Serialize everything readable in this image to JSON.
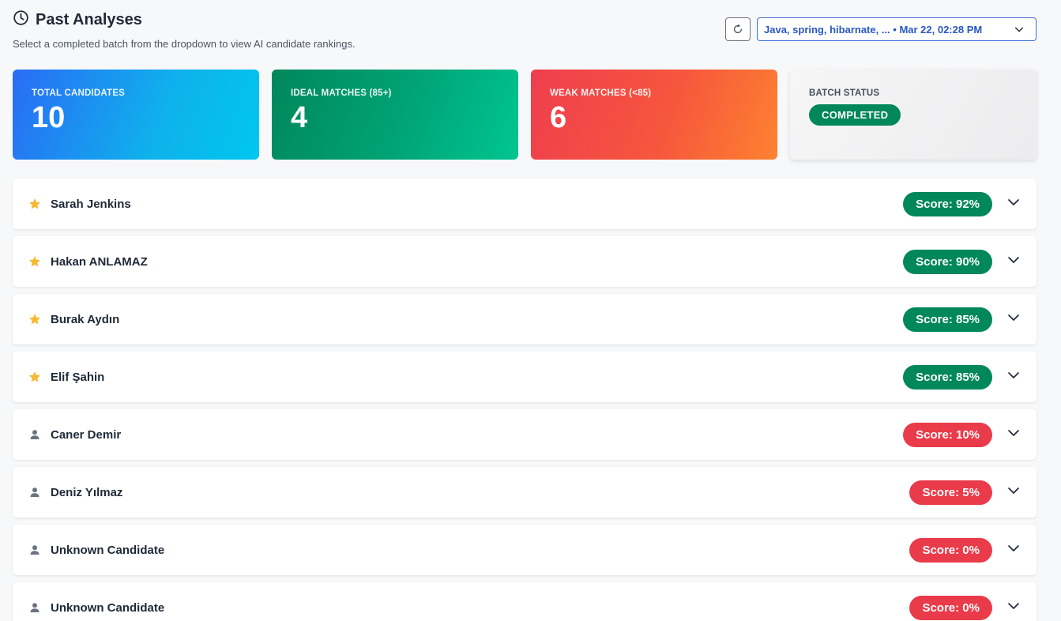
{
  "header": {
    "title": "Past Analyses",
    "subtitle": "Select a completed batch from the dropdown to view AI candidate rankings."
  },
  "controls": {
    "batch_selected": "Java, spring, hibarnate, ... • Mar 22, 02:28 PM"
  },
  "stats": [
    {
      "label": "TOTAL CANDIDATES",
      "value": "10"
    },
    {
      "label": "IDEAL MATCHES (85+)",
      "value": "4"
    },
    {
      "label": "WEAK MATCHES (<85)",
      "value": "6"
    }
  ],
  "status": {
    "label": "BATCH STATUS",
    "value": "COMPLETED"
  },
  "candidates": [
    {
      "name": "Sarah Jenkins",
      "score": "Score: 92%",
      "icon": "star-icon"
    },
    {
      "name": "Hakan ANLAMAZ",
      "score": "Score: 90%",
      "icon": "star-icon"
    },
    {
      "name": "Burak Aydın",
      "score": "Score: 85%",
      "icon": "star-icon"
    },
    {
      "name": "Elif Şahin",
      "score": "Score: 85%",
      "icon": "star-icon"
    },
    {
      "name": "Caner Demir",
      "score": "Score: 10%",
      "icon": "user-icon"
    },
    {
      "name": "Deniz Yılmaz",
      "score": "Score: 5%",
      "icon": "user-icon"
    },
    {
      "name": "Unknown Candidate",
      "score": "Score: 0%",
      "icon": "user-icon"
    },
    {
      "name": "Unknown Candidate",
      "score": "Score: 0%",
      "icon": "user-icon"
    }
  ],
  "colors": {
    "good": "#00875a",
    "bad": "#ea3b4a",
    "star": "#f5b932",
    "user": "#6b7280"
  }
}
